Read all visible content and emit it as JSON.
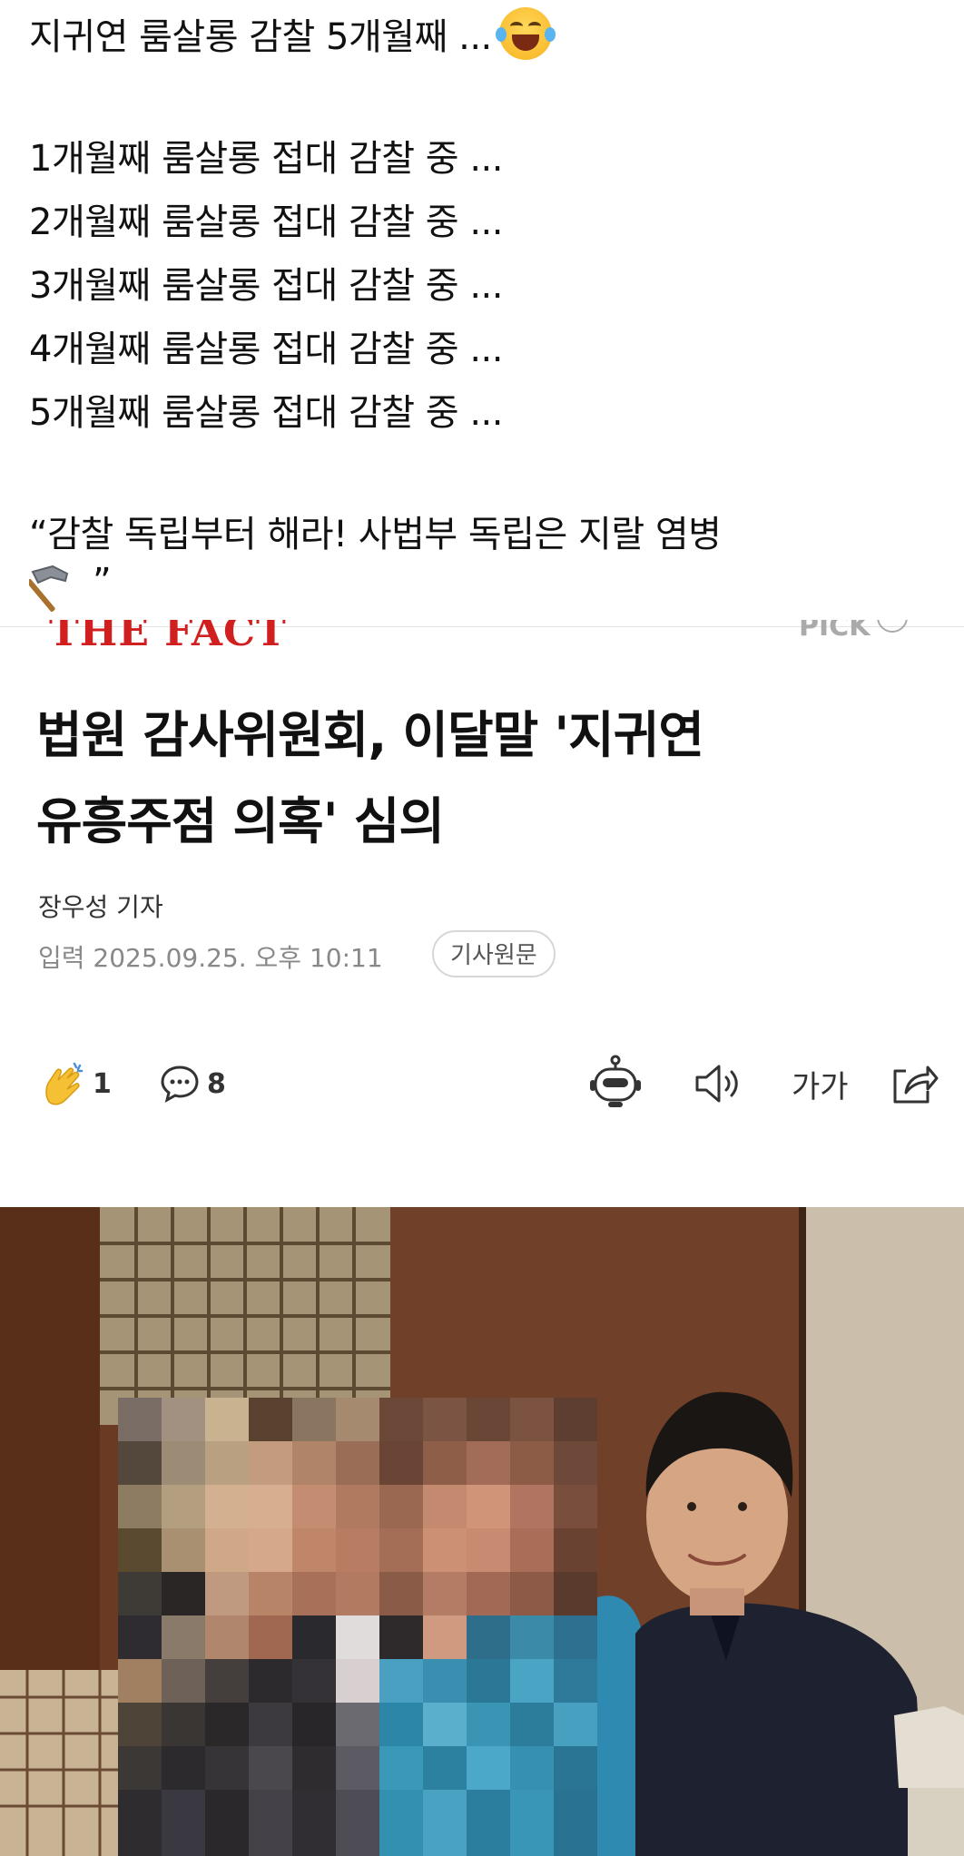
{
  "post": {
    "title": "지귀연 룸살롱 감찰 5개월째 ...",
    "lines": [
      "1개월째 룸살롱 접대 감찰 중 ...",
      "2개월째 룸살롱 접대 감찰 중 ...",
      "3개월째 룸살롱 접대 감찰 중 ...",
      "4개월째 룸살롱 접대 감찰 중 ...",
      "5개월째 룸살롱 접대 감찰 중 ..."
    ],
    "quote_line": "“감찰 독립부터 해라! 사법부 독립은 지랄 염병",
    "quote_close": "”",
    "title_emoji": "face-with-tears-of-joy",
    "quote_emoji": "hammer"
  },
  "article": {
    "source_logo": "THE FACT",
    "pick_label": "PICK",
    "headline": [
      "법원 감사위원회, 이달말 '지귀연",
      "유흥주점 의혹' 심의"
    ],
    "reporter": "장우성 기자",
    "date": "입력 2025.09.25. 오후 10:11",
    "original_button": "기사원문",
    "like_count": "1",
    "comment_count": "8",
    "font_size_label": "가가",
    "accent_color": "#d11f1f"
  }
}
